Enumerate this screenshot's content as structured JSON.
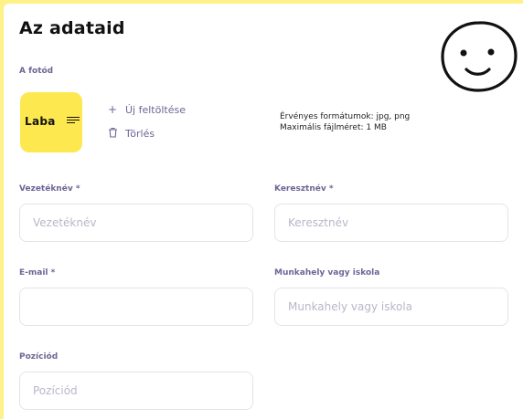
{
  "title": "Az adataid",
  "photo": {
    "label": "A fotód",
    "logo_text": "Laba",
    "upload_label": "Új feltöltése",
    "delete_label": "Törlés",
    "formats_line1": "Érvényes formátumok: jpg, png",
    "formats_line2": "Maximális fájlméret: 1 MB"
  },
  "fields": {
    "last_name": {
      "label": "Vezetéknév *",
      "placeholder": "Vezetéknév",
      "value": ""
    },
    "first_name": {
      "label": "Keresztnév *",
      "placeholder": "Keresztnév",
      "value": ""
    },
    "email": {
      "label": "E-mail *",
      "placeholder": "",
      "value": ""
    },
    "workplace": {
      "label": "Munkahely vagy iskola",
      "placeholder": "Munkahely vagy iskola",
      "value": ""
    },
    "position": {
      "label": "Pozíciód",
      "placeholder": "Pozíciód",
      "value": ""
    }
  },
  "icons": {
    "upload": "plus-icon",
    "delete": "trash-icon",
    "decoration": "smiley-face-icon"
  },
  "colors": {
    "background": "#fdf28a",
    "accent_label": "#6d6596",
    "logo_bg": "#fde84f"
  }
}
